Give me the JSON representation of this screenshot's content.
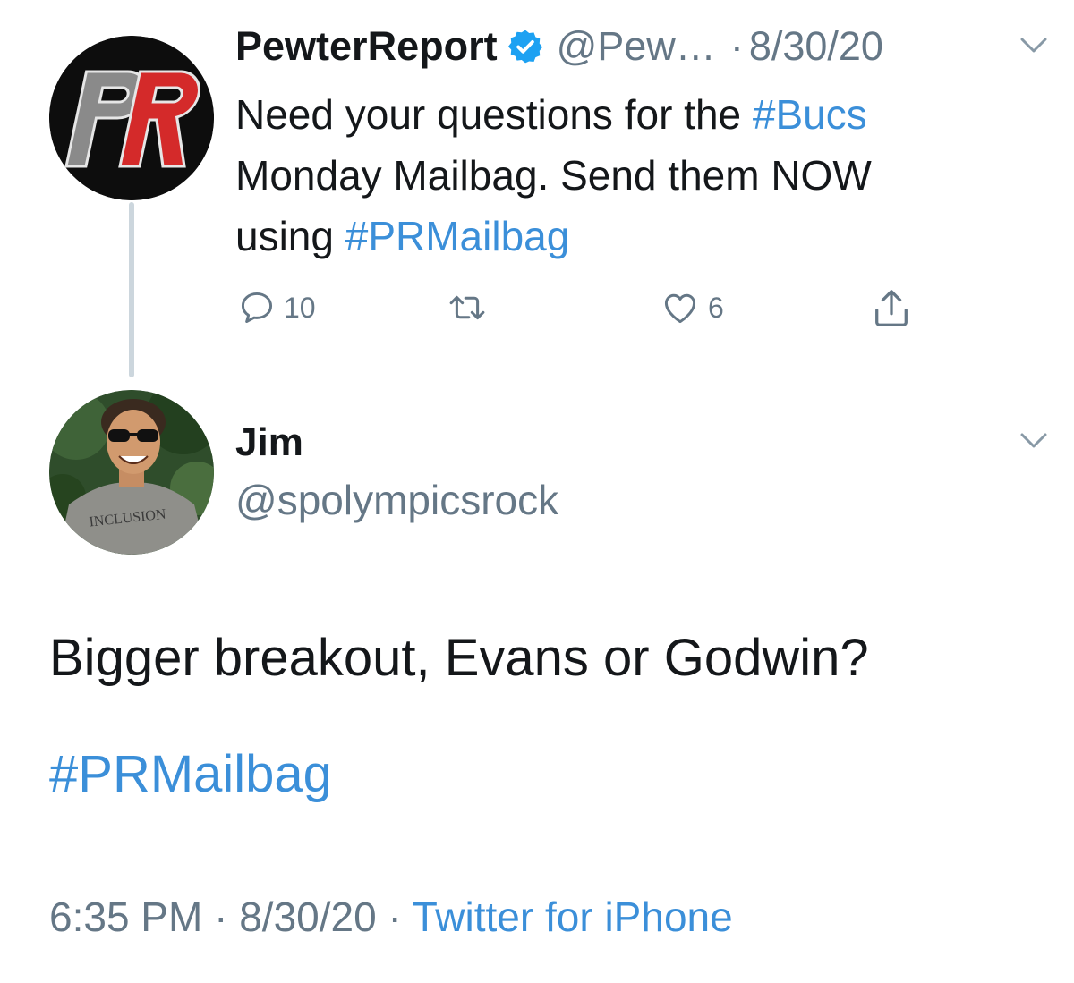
{
  "parent_tweet": {
    "avatar_text": "PR",
    "display_name": "PewterReport",
    "verified": true,
    "handle": "@Pew…",
    "separator": "·",
    "date": "8/30/20",
    "text_parts": {
      "line1_a": "Need your questions for the ",
      "line1_hashtag": "#Bucs",
      "line2": "Monday Mailbag. Send them NOW",
      "line3_a": "using ",
      "line3_hashtag": "#PRMailbag"
    },
    "actions": {
      "reply_count": "10",
      "retweet_count": "",
      "like_count": "6"
    }
  },
  "reply_tweet": {
    "display_name": "Jim",
    "handle": "@spolympicsrock",
    "avatar_shirt_text": "INCLUSION",
    "text": "Bigger breakout, Evans or Godwin?",
    "hashtag": "#PRMailbag",
    "timestamp": {
      "time": "6:35 PM",
      "sep1": " · ",
      "date": "8/30/20",
      "sep2": " · ",
      "source": "Twitter for iPhone"
    }
  },
  "colors": {
    "link": "#3b8fd9",
    "muted": "#657786",
    "verified": "#1da1f2",
    "pr_grey": "#8a8a8a",
    "pr_red": "#d42a2a"
  },
  "icons": {
    "reply": "speech-bubble-icon",
    "retweet": "retweet-arrows-icon",
    "like": "heart-icon",
    "share": "share-upload-icon",
    "menu": "chevron-down-icon",
    "verified": "verified-badge-icon"
  }
}
